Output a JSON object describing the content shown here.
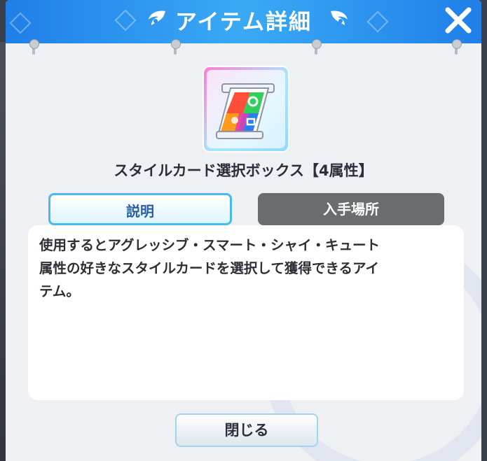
{
  "header": {
    "title": "アイテム詳細",
    "close_icon": "close-icon",
    "wing_icon": "wing-icon"
  },
  "item": {
    "name": "スタイルカード選択ボックス【4属性】",
    "icon": "style-card-box-icon"
  },
  "tabs": [
    {
      "label": "説明",
      "active": true
    },
    {
      "label": "入手場所",
      "active": false
    }
  ],
  "description": {
    "text": "使用するとアグレッシブ・スマート・シャイ・キュート\n属性の好きなスタイルカードを選択して獲得できるアイ\nテム。"
  },
  "footer": {
    "close_label": "閉じる"
  },
  "colors": {
    "header_blue": "#2a8ff0",
    "tab_active_border": "#4bb8ee",
    "tab_inactive": "#6b6c70",
    "panel_bg": "#ffffff"
  }
}
